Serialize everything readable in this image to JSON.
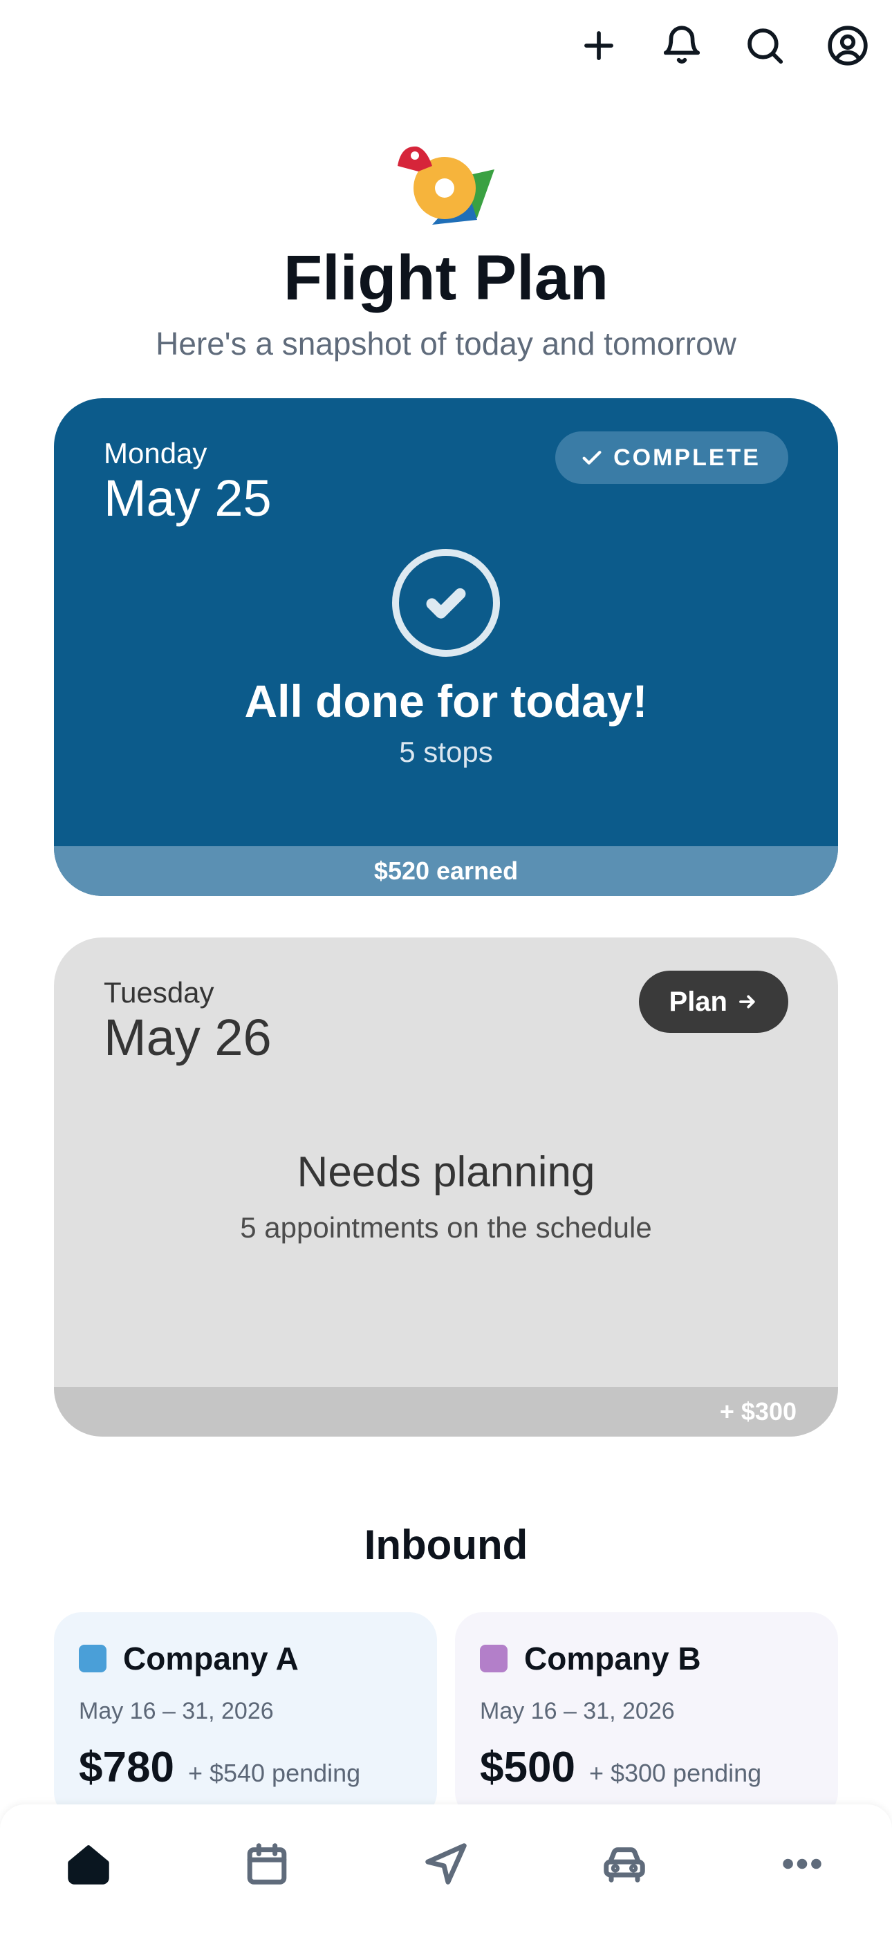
{
  "header": {
    "app_title": "Flight Plan",
    "subtitle": "Here's a snapshot of today and tomorrow",
    "icons": [
      "plus-icon",
      "bell-icon",
      "search-icon",
      "account-icon"
    ]
  },
  "today": {
    "weekday": "Monday",
    "date": "May 25",
    "badge": "COMPLETE",
    "headline": "All done for today!",
    "stops": "5 stops",
    "earned": "$520 earned",
    "colors": {
      "card": "#0c5b8b",
      "footer": "#5b90b3"
    }
  },
  "tomorrow": {
    "weekday": "Tuesday",
    "date": "May 26",
    "plan_label": "Plan",
    "headline": "Needs planning",
    "detail": "5 appointments on the schedule",
    "projected": "+ $300",
    "colors": {
      "card": "#e0e0e0",
      "footer": "#c5c5c5"
    }
  },
  "inbound": {
    "title": "Inbound",
    "companies": [
      {
        "name": "Company A",
        "dates": "May 16 – 31, 2026",
        "amount": "$780",
        "pending": "+ $540 pending",
        "color": "#4a9fd8"
      },
      {
        "name": "Company B",
        "dates": "May 16 – 31, 2026",
        "amount": "$500",
        "pending": "+ $300 pending",
        "color": "#b37fc9"
      }
    ]
  },
  "nav": {
    "items": [
      "home-icon",
      "calendar-icon",
      "navigation-icon",
      "car-icon",
      "more-icon"
    ],
    "active": "home-icon"
  }
}
